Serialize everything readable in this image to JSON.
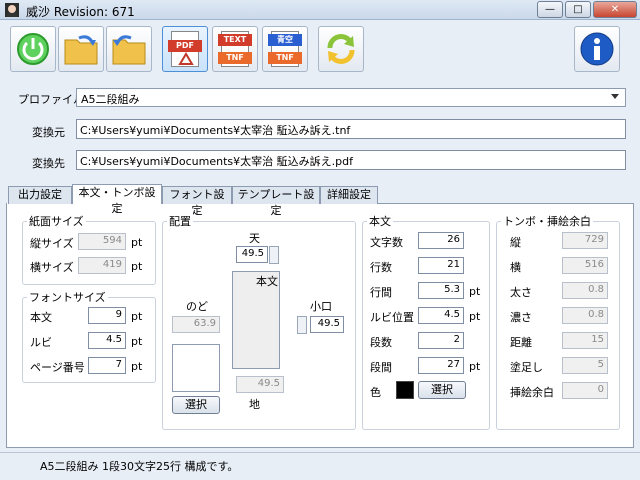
{
  "window": {
    "title": "威沙 Revision: 671",
    "min_label": "—",
    "max_label": "□",
    "close_label": "✕"
  },
  "toolbar": {
    "pdf_label": "PDF",
    "text_label": "TEXT",
    "tnf_label": "TNF",
    "aozora_label": "青空",
    "tnf2_label": "TNF"
  },
  "profile": {
    "label": "プロファイル",
    "value": "A5二段組み"
  },
  "source": {
    "label": "変換元",
    "value": "C:¥Users¥yumi¥Documents¥太宰治 駈込み訴え.tnf"
  },
  "dest": {
    "label": "変換先",
    "value": "C:¥Users¥yumi¥Documents¥太宰治 駈込み訴え.pdf"
  },
  "tabs": [
    "出力設定",
    "本文・トンボ設定",
    "フォント設定",
    "テンプレート設定",
    "詳細設定"
  ],
  "paper": {
    "title": "紙面サイズ",
    "height_label": "縦サイズ",
    "height_value": "594",
    "width_label": "横サイズ",
    "width_value": "419",
    "unit": "pt"
  },
  "font_size": {
    "title": "フォントサイズ",
    "body_label": "本文",
    "body_value": "9",
    "ruby_label": "ルビ",
    "ruby_value": "4.5",
    "page_label": "ページ番号",
    "page_value": "7",
    "unit": "pt"
  },
  "layout": {
    "title": "配置",
    "top_label": "天",
    "top_value": "49.5",
    "body_label": "本文",
    "gutter_label": "のど",
    "gutter_value": "63.9",
    "fore_label": "小口",
    "fore_value": "49.5",
    "bottom_value": "49.5",
    "bottom_label": "地",
    "select_label": "選択"
  },
  "body": {
    "title": "本文",
    "chars_label": "文字数",
    "chars_value": "26",
    "lines_label": "行数",
    "lines_value": "21",
    "spacing_label": "行間",
    "spacing_value": "5.3",
    "ruby_pos_label": "ルビ位置",
    "ruby_pos_value": "4.5",
    "cols_label": "段数",
    "cols_value": "2",
    "col_gap_label": "段間",
    "col_gap_value": "27",
    "color_label": "色",
    "color_value": "#000000",
    "select_label": "選択",
    "unit": "pt"
  },
  "tombo": {
    "title": "トンボ・挿絵余白",
    "v_label": "縦",
    "v_value": "729",
    "h_label": "横",
    "h_value": "516",
    "thick_label": "太さ",
    "thick_value": "0.8",
    "dark_label": "濃さ",
    "dark_value": "0.8",
    "dist_label": "距離",
    "dist_value": "15",
    "bleed_label": "塗足し",
    "bleed_value": "5",
    "margin_label": "挿絵余白",
    "margin_value": "0"
  },
  "status": {
    "text": "A5二段組み 1段30文字25行 構成です。"
  }
}
